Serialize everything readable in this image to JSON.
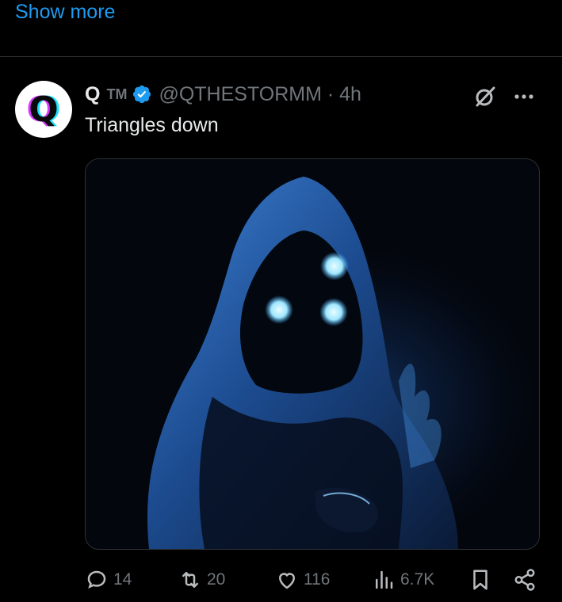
{
  "show_more": "Show more",
  "tweet": {
    "author_name": "Q",
    "author_tm": "TM",
    "handle_time": "@QTHESTORMM · 4h",
    "avatar_letter": "Q",
    "text": "Triangles down"
  },
  "actions": {
    "replies": "14",
    "reposts": "20",
    "likes": "116",
    "views": "6.7K"
  },
  "colors": {
    "accent": "#1d9bf0",
    "text": "#e7e9ea",
    "muted": "#71767b",
    "background": "#000000"
  }
}
